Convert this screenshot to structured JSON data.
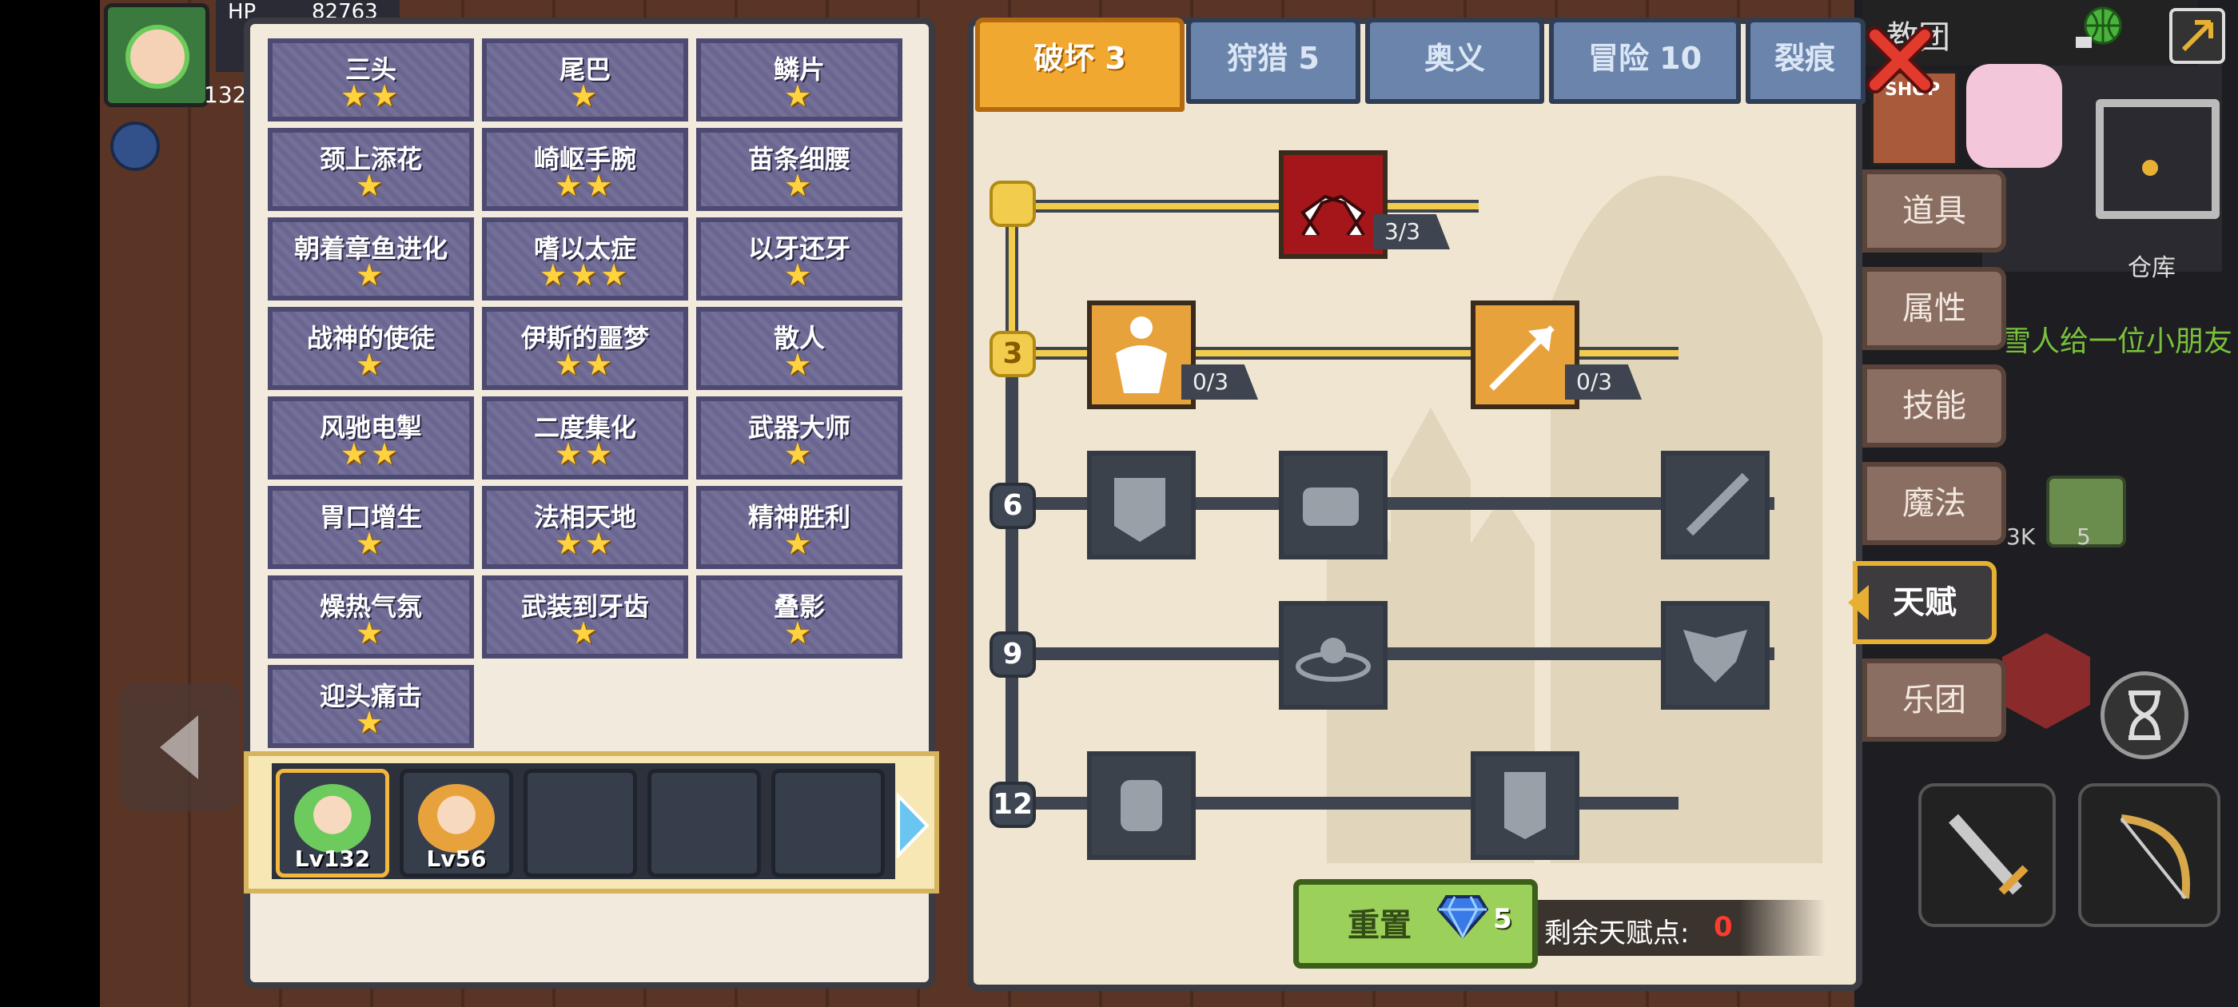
{
  "hud": {
    "hp_label": "HP",
    "hp_value": "82763",
    "player_level": "132",
    "place": "教团",
    "warehouse_label": "仓库",
    "shop_text": "SHOP",
    "scroll_message": "雪人给一位小朋友",
    "item_count_1": "3K",
    "item_count_2": "5"
  },
  "talents": [
    {
      "name": "三头",
      "stars": 2
    },
    {
      "name": "尾巴",
      "stars": 1
    },
    {
      "name": "鳞片",
      "stars": 1
    },
    {
      "name": "颈上添花",
      "stars": 1
    },
    {
      "name": "崎岖手腕",
      "stars": 2
    },
    {
      "name": "苗条细腰",
      "stars": 1
    },
    {
      "name": "朝着章鱼进化",
      "stars": 1
    },
    {
      "name": "嗜以太症",
      "stars": 3
    },
    {
      "name": "以牙还牙",
      "stars": 1
    },
    {
      "name": "战神的使徒",
      "stars": 1
    },
    {
      "name": "伊斯的噩梦",
      "stars": 2
    },
    {
      "name": "散人",
      "stars": 1
    },
    {
      "name": "风驰电掣",
      "stars": 2
    },
    {
      "name": "二度集化",
      "stars": 2
    },
    {
      "name": "武器大师",
      "stars": 1
    },
    {
      "name": "胃口增生",
      "stars": 1
    },
    {
      "name": "法相天地",
      "stars": 2
    },
    {
      "name": "精神胜利",
      "stars": 1
    },
    {
      "name": "燥热气氛",
      "stars": 1
    },
    {
      "name": "武装到牙齿",
      "stars": 1
    },
    {
      "name": "叠影",
      "stars": 1
    },
    {
      "name": "迎头痛击",
      "stars": 1
    }
  ],
  "characters": [
    {
      "level": "Lv132",
      "color": "#6ccb5c"
    },
    {
      "level": "Lv56",
      "color": "#e8a23c"
    }
  ],
  "tabs": [
    {
      "label": "破坏 3",
      "active": true
    },
    {
      "label": "狩猎 5",
      "active": false
    },
    {
      "label": "奥义",
      "active": false
    },
    {
      "label": "冒险 10",
      "active": false
    },
    {
      "label": "裂痕",
      "active": false
    }
  ],
  "tree": {
    "tiers": [
      "3",
      "6",
      "9",
      "12"
    ],
    "node_counts": {
      "arm_wrestle": "3/3",
      "muscle": "0/3",
      "arrow": "0/3"
    }
  },
  "reset": {
    "label": "重置",
    "cost": "5",
    "remaining_label": "剩余天赋点:",
    "remaining_value": "0"
  },
  "side_menu": [
    {
      "label": "道具",
      "active": false
    },
    {
      "label": "属性",
      "active": false
    },
    {
      "label": "技能",
      "active": false
    },
    {
      "label": "魔法",
      "active": false
    },
    {
      "label": "天赋",
      "active": true
    },
    {
      "label": "乐团",
      "active": false
    }
  ],
  "colors": {
    "accent": "#f0a830",
    "star": "#ffd23f",
    "remaining": "#ff3b30",
    "reset_green": "#9bd05a"
  }
}
